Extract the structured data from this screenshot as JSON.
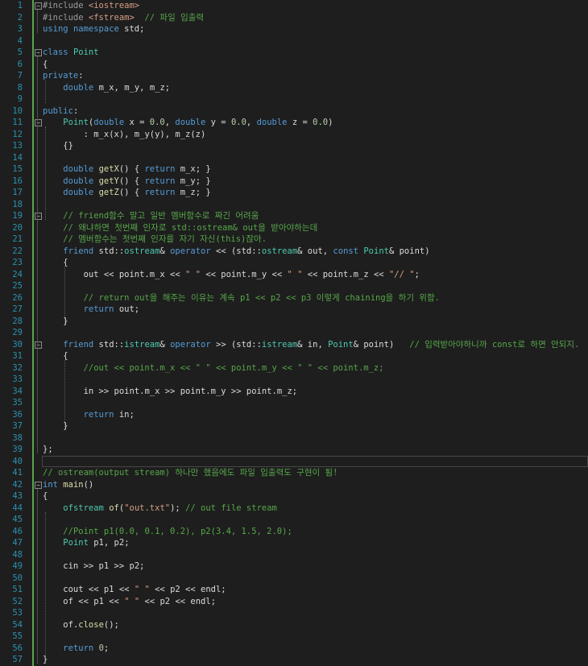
{
  "line_numbers": [
    "1",
    "2",
    "3",
    "4",
    "5",
    "6",
    "7",
    "8",
    "9",
    "10",
    "11",
    "12",
    "13",
    "14",
    "15",
    "16",
    "17",
    "18",
    "19",
    "20",
    "21",
    "22",
    "23",
    "24",
    "25",
    "26",
    "27",
    "28",
    "29",
    "30",
    "31",
    "32",
    "33",
    "34",
    "35",
    "36",
    "37",
    "38",
    "39",
    "40",
    "41",
    "42",
    "43",
    "44",
    "45",
    "46",
    "47",
    "48",
    "49",
    "50",
    "51",
    "52",
    "53",
    "54",
    "55",
    "56",
    "57"
  ],
  "colors": {
    "background": "#1e1e1e",
    "line_number": "#2b91af",
    "keyword": "#569cd6",
    "type": "#4ec9b0",
    "string": "#d69d85",
    "comment": "#57a64a",
    "change_bar": "#57a64a"
  },
  "code_lines": [
    [
      [
        "pp",
        "#include "
      ],
      [
        "str",
        "<iostream>"
      ]
    ],
    [
      [
        "pp",
        "#include "
      ],
      [
        "str",
        "<fstream>"
      ],
      [
        "txt",
        "  "
      ],
      [
        "cm",
        "// 파일 입출력"
      ]
    ],
    [
      [
        "kw",
        "using"
      ],
      [
        "txt",
        " "
      ],
      [
        "kw",
        "namespace"
      ],
      [
        "txt",
        " std;"
      ]
    ],
    [],
    [
      [
        "kw",
        "class"
      ],
      [
        "txt",
        " "
      ],
      [
        "ty",
        "Point"
      ]
    ],
    [
      [
        "txt",
        "{"
      ]
    ],
    [
      [
        "kw",
        "private"
      ],
      [
        "txt",
        ":"
      ]
    ],
    [
      [
        "txt",
        "    "
      ],
      [
        "kw",
        "double"
      ],
      [
        "txt",
        " "
      ],
      [
        "mem",
        "m_x"
      ],
      [
        "txt",
        ", "
      ],
      [
        "mem",
        "m_y"
      ],
      [
        "txt",
        ", "
      ],
      [
        "mem",
        "m_z"
      ],
      [
        "txt",
        ";"
      ]
    ],
    [],
    [
      [
        "kw",
        "public"
      ],
      [
        "txt",
        ":"
      ]
    ],
    [
      [
        "txt",
        "    "
      ],
      [
        "ty",
        "Point"
      ],
      [
        "txt",
        "("
      ],
      [
        "kw",
        "double"
      ],
      [
        "txt",
        " x = "
      ],
      [
        "num",
        "0.0"
      ],
      [
        "txt",
        ", "
      ],
      [
        "kw",
        "double"
      ],
      [
        "txt",
        " y = "
      ],
      [
        "num",
        "0.0"
      ],
      [
        "txt",
        ", "
      ],
      [
        "kw",
        "double"
      ],
      [
        "txt",
        " z = "
      ],
      [
        "num",
        "0.0"
      ],
      [
        "txt",
        ")"
      ]
    ],
    [
      [
        "txt",
        "        : "
      ],
      [
        "mem",
        "m_x"
      ],
      [
        "txt",
        "(x), "
      ],
      [
        "mem",
        "m_y"
      ],
      [
        "txt",
        "(y), "
      ],
      [
        "mem",
        "m_z"
      ],
      [
        "txt",
        "(z)"
      ]
    ],
    [
      [
        "txt",
        "    {}"
      ]
    ],
    [],
    [
      [
        "txt",
        "    "
      ],
      [
        "kw",
        "double"
      ],
      [
        "txt",
        " "
      ],
      [
        "fn",
        "getX"
      ],
      [
        "txt",
        "() { "
      ],
      [
        "kw",
        "return"
      ],
      [
        "txt",
        " "
      ],
      [
        "mem",
        "m_x"
      ],
      [
        "txt",
        "; }"
      ]
    ],
    [
      [
        "txt",
        "    "
      ],
      [
        "kw",
        "double"
      ],
      [
        "txt",
        " "
      ],
      [
        "fn",
        "getY"
      ],
      [
        "txt",
        "() { "
      ],
      [
        "kw",
        "return"
      ],
      [
        "txt",
        " "
      ],
      [
        "mem",
        "m_y"
      ],
      [
        "txt",
        "; }"
      ]
    ],
    [
      [
        "txt",
        "    "
      ],
      [
        "kw",
        "double"
      ],
      [
        "txt",
        " "
      ],
      [
        "fn",
        "getZ"
      ],
      [
        "txt",
        "() { "
      ],
      [
        "kw",
        "return"
      ],
      [
        "txt",
        " "
      ],
      [
        "mem",
        "m_z"
      ],
      [
        "txt",
        "; }"
      ]
    ],
    [],
    [
      [
        "txt",
        "    "
      ],
      [
        "cm",
        "// friend함수 말고 일반 멤버함수로 짜긴 어려움"
      ]
    ],
    [
      [
        "txt",
        "    "
      ],
      [
        "cm",
        "// 왜냐하면 첫번째 인자로 std::ostream& out을 받아야하는데"
      ]
    ],
    [
      [
        "txt",
        "    "
      ],
      [
        "cm",
        "// 멤버함수는 첫번째 인자를 자기 자신(this)잖아."
      ]
    ],
    [
      [
        "txt",
        "    "
      ],
      [
        "kw",
        "friend"
      ],
      [
        "txt",
        " std::"
      ],
      [
        "ty",
        "ostream"
      ],
      [
        "txt",
        "& "
      ],
      [
        "kw",
        "operator"
      ],
      [
        "txt",
        " << (std::"
      ],
      [
        "ty",
        "ostream"
      ],
      [
        "txt",
        "& out, "
      ],
      [
        "kw",
        "const"
      ],
      [
        "txt",
        " "
      ],
      [
        "ty",
        "Point"
      ],
      [
        "txt",
        "& point)"
      ]
    ],
    [
      [
        "txt",
        "    {"
      ]
    ],
    [
      [
        "txt",
        "        out << point."
      ],
      [
        "mem",
        "m_x"
      ],
      [
        "txt",
        " << "
      ],
      [
        "str",
        "\" \""
      ],
      [
        "txt",
        " << point."
      ],
      [
        "mem",
        "m_y"
      ],
      [
        "txt",
        " << "
      ],
      [
        "str",
        "\" \""
      ],
      [
        "txt",
        " << point."
      ],
      [
        "mem",
        "m_z"
      ],
      [
        "txt",
        " << "
      ],
      [
        "str",
        "\"// \""
      ],
      [
        "txt",
        ";"
      ]
    ],
    [],
    [
      [
        "txt",
        "        "
      ],
      [
        "cm",
        "// return out을 해주는 이유는 계속 p1 << p2 << p3 이렇게 chaining을 하기 위함."
      ]
    ],
    [
      [
        "txt",
        "        "
      ],
      [
        "kw",
        "return"
      ],
      [
        "txt",
        " out;"
      ]
    ],
    [
      [
        "txt",
        "    }"
      ]
    ],
    [],
    [
      [
        "txt",
        "    "
      ],
      [
        "kw",
        "friend"
      ],
      [
        "txt",
        " std::"
      ],
      [
        "ty",
        "istream"
      ],
      [
        "txt",
        "& "
      ],
      [
        "kw",
        "operator"
      ],
      [
        "txt",
        " >> (std::"
      ],
      [
        "ty",
        "istream"
      ],
      [
        "txt",
        "& in, "
      ],
      [
        "ty",
        "Point"
      ],
      [
        "txt",
        "& point)   "
      ],
      [
        "cm",
        "// 입력받아야하니까 const로 하면 안되지."
      ]
    ],
    [
      [
        "txt",
        "    {"
      ]
    ],
    [
      [
        "txt",
        "        "
      ],
      [
        "cm",
        "//out << point.m_x << \" \" << point.m_y << \" \" << point.m_z;"
      ]
    ],
    [],
    [
      [
        "txt",
        "        in >> point."
      ],
      [
        "mem",
        "m_x"
      ],
      [
        "txt",
        " >> point."
      ],
      [
        "mem",
        "m_y"
      ],
      [
        "txt",
        " >> point."
      ],
      [
        "mem",
        "m_z"
      ],
      [
        "txt",
        ";"
      ]
    ],
    [],
    [
      [
        "txt",
        "        "
      ],
      [
        "kw",
        "return"
      ],
      [
        "txt",
        " in;"
      ]
    ],
    [
      [
        "txt",
        "    }"
      ]
    ],
    [],
    [
      [
        "txt",
        "};"
      ]
    ],
    [],
    [
      [
        "cm",
        "// ostream(output stream) 하나만 했음에도 파일 입출력도 구현이 됨!"
      ]
    ],
    [
      [
        "kw",
        "int"
      ],
      [
        "txt",
        " "
      ],
      [
        "fn",
        "main"
      ],
      [
        "txt",
        "()"
      ]
    ],
    [
      [
        "txt",
        "{"
      ]
    ],
    [
      [
        "txt",
        "    "
      ],
      [
        "ty",
        "ofstream"
      ],
      [
        "txt",
        " "
      ],
      [
        "fn",
        "of"
      ],
      [
        "txt",
        "("
      ],
      [
        "str",
        "\"out.txt\""
      ],
      [
        "txt",
        "); "
      ],
      [
        "cm",
        "// out file stream"
      ]
    ],
    [],
    [
      [
        "txt",
        "    "
      ],
      [
        "cm",
        "//Point p1(0.0, 0.1, 0.2), p2(3.4, 1.5, 2.0);"
      ]
    ],
    [
      [
        "txt",
        "    "
      ],
      [
        "ty",
        "Point"
      ],
      [
        "txt",
        " "
      ],
      [
        "mem",
        "p1"
      ],
      [
        "txt",
        ", "
      ],
      [
        "mem",
        "p2"
      ],
      [
        "txt",
        ";"
      ]
    ],
    [],
    [
      [
        "txt",
        "    cin >> "
      ],
      [
        "mem",
        "p1"
      ],
      [
        "txt",
        " >> "
      ],
      [
        "mem",
        "p2"
      ],
      [
        "txt",
        ";"
      ]
    ],
    [],
    [
      [
        "txt",
        "    cout << "
      ],
      [
        "mem",
        "p1"
      ],
      [
        "txt",
        " << "
      ],
      [
        "str",
        "\" \""
      ],
      [
        "txt",
        " << "
      ],
      [
        "mem",
        "p2"
      ],
      [
        "txt",
        " << endl;"
      ]
    ],
    [
      [
        "txt",
        "    "
      ],
      [
        "mem",
        "of"
      ],
      [
        "txt",
        " << "
      ],
      [
        "mem",
        "p1"
      ],
      [
        "txt",
        " << "
      ],
      [
        "str",
        "\" \""
      ],
      [
        "txt",
        " << "
      ],
      [
        "mem",
        "p2"
      ],
      [
        "txt",
        " << endl;"
      ]
    ],
    [],
    [
      [
        "txt",
        "    "
      ],
      [
        "mem",
        "of"
      ],
      [
        "txt",
        "."
      ],
      [
        "fn",
        "close"
      ],
      [
        "txt",
        "();"
      ]
    ],
    [],
    [
      [
        "txt",
        "    "
      ],
      [
        "kw",
        "return"
      ],
      [
        "txt",
        " "
      ],
      [
        "num",
        "0"
      ],
      [
        "txt",
        ";"
      ]
    ],
    [
      [
        "txt",
        "}"
      ]
    ]
  ],
  "fold_lines": [
    1,
    5,
    11,
    19,
    30,
    42
  ],
  "current_line": 40
}
